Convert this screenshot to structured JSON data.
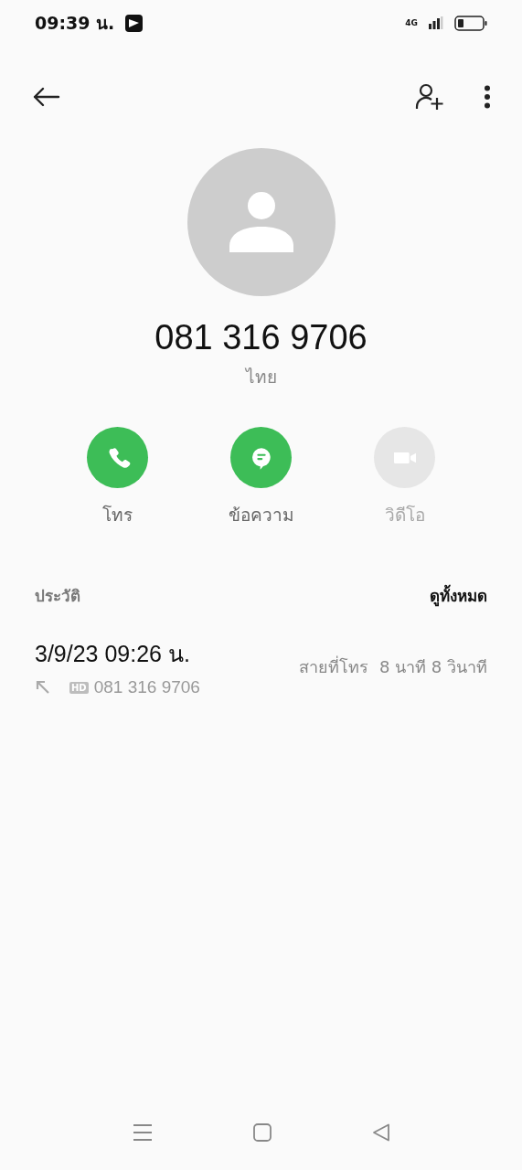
{
  "status_bar": {
    "time": "09:39 น.",
    "network": "4G"
  },
  "contact": {
    "number": "081 316 9706",
    "region": "ไทย"
  },
  "actions": [
    {
      "kind": "call",
      "label": "โทร",
      "disabled": false
    },
    {
      "kind": "message",
      "label": "ข้อความ",
      "disabled": false
    },
    {
      "kind": "video",
      "label": "วิดีโอ",
      "disabled": true
    }
  ],
  "history": {
    "title": "ประวัติ",
    "view_all": "ดูทั้งหมด",
    "entries": [
      {
        "date": "3/9/23 09:26 น.",
        "badge": "HD",
        "number": "081 316 9706",
        "outgoing": true,
        "duration": "สายที่โทร  8 นาที 8 วินาที"
      }
    ]
  }
}
